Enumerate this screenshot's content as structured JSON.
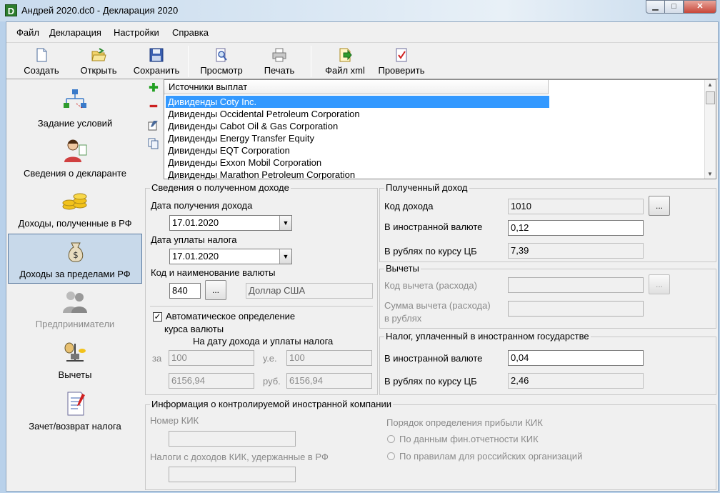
{
  "window": {
    "title": "Андрей 2020.dc0 - Декларация 2020",
    "icon_letter": "D",
    "minimize_glyph": "▁",
    "maximize_glyph": "□",
    "close_glyph": "✕"
  },
  "menu": [
    "Файл",
    "Декларация",
    "Настройки",
    "Справка"
  ],
  "toolbar": {
    "create": "Создать",
    "open": "Открыть",
    "save": "Сохранить",
    "preview": "Просмотр",
    "print": "Печать",
    "xml": "Файл xml",
    "check": "Проверить"
  },
  "sidebar": {
    "items": [
      {
        "label": "Задание условий",
        "icon": "tree-icon"
      },
      {
        "label": "Сведения о декларанте",
        "icon": "person-icon"
      },
      {
        "label": "Доходы, полученные в РФ",
        "icon": "coins-icon"
      },
      {
        "label": "Доходы за пределами РФ",
        "icon": "money-bag-icon"
      },
      {
        "label": "Предприниматели",
        "icon": "businessmen-icon"
      },
      {
        "label": "Вычеты",
        "icon": "scales-icon"
      },
      {
        "label": "Зачет/возврат налога",
        "icon": "document-icon"
      }
    ],
    "active_index": 3
  },
  "list": {
    "header": "Источники выплат",
    "rows": [
      "Дивиденды Coty Inc.",
      "Дивиденды Occidental Petroleum Corporation",
      "Дивиденды Cabot Oil & Gas Corporation",
      "Дивиденды Energy Transfer Equity",
      "Дивиденды EQT Corporation",
      "Дивиденды Exxon Mobil Corporation",
      "Дивиденды Marathon Petroleum Corporation"
    ],
    "selected_index": 0
  },
  "income_info": {
    "title": "Сведения о полученном доходе",
    "date_received_label": "Дата получения дохода",
    "date_received": "17.01.2020",
    "tax_paid_date_label": "Дата уплаты налога",
    "tax_paid_date": "17.01.2020",
    "currency_label": "Код и наименование валюты",
    "currency_code": "840",
    "currency_name": "Доллар США",
    "dots": "...",
    "auto_rate_label": "Автоматическое определение",
    "auto_rate_label2": "курса валюты",
    "auto_rate_checked": "✓",
    "on_date_label": "На дату дохода и уплаты налога",
    "per_label": "за",
    "ue_label": "у.е.",
    "rub_label": "руб.",
    "per_value_1": "100",
    "ue_value": "100",
    "rate_value_1": "6156,94",
    "rate_value_2": "6156,94"
  },
  "received_income": {
    "title": "Полученный доход",
    "code_label": "Код дохода",
    "code_value": "1010",
    "foreign_label": "В иностранной валюте",
    "foreign_value": "0,12",
    "rub_label": "В рублях по курсу ЦБ",
    "rub_value": "7,39"
  },
  "deductions": {
    "title": "Вычеты",
    "code_label": "Код вычета (расхода)",
    "sum_label": "Сумма вычета (расхода)",
    "sum_label2": "в рублях"
  },
  "foreign_tax": {
    "title": "Налог, уплаченный в иностранном государстве",
    "foreign_label": "В иностранной валюте",
    "foreign_value": "0,04",
    "rub_label": "В рублях по курсу ЦБ",
    "rub_value": "2,46"
  },
  "cfc": {
    "title": "Информация о контролируемой иностранной компании",
    "number_label": "Номер КИК",
    "taxes_label": "Налоги с доходов КИК, удержанные в РФ",
    "profit_order_label": "Порядок определения прибыли КИК",
    "option_1": "По данным фин.отчетности КИК",
    "option_2": "По правилам для российских организаций"
  },
  "colors": {
    "selection": "#3399ff",
    "add_icon": "#22a022",
    "remove_icon": "#cc2020"
  }
}
